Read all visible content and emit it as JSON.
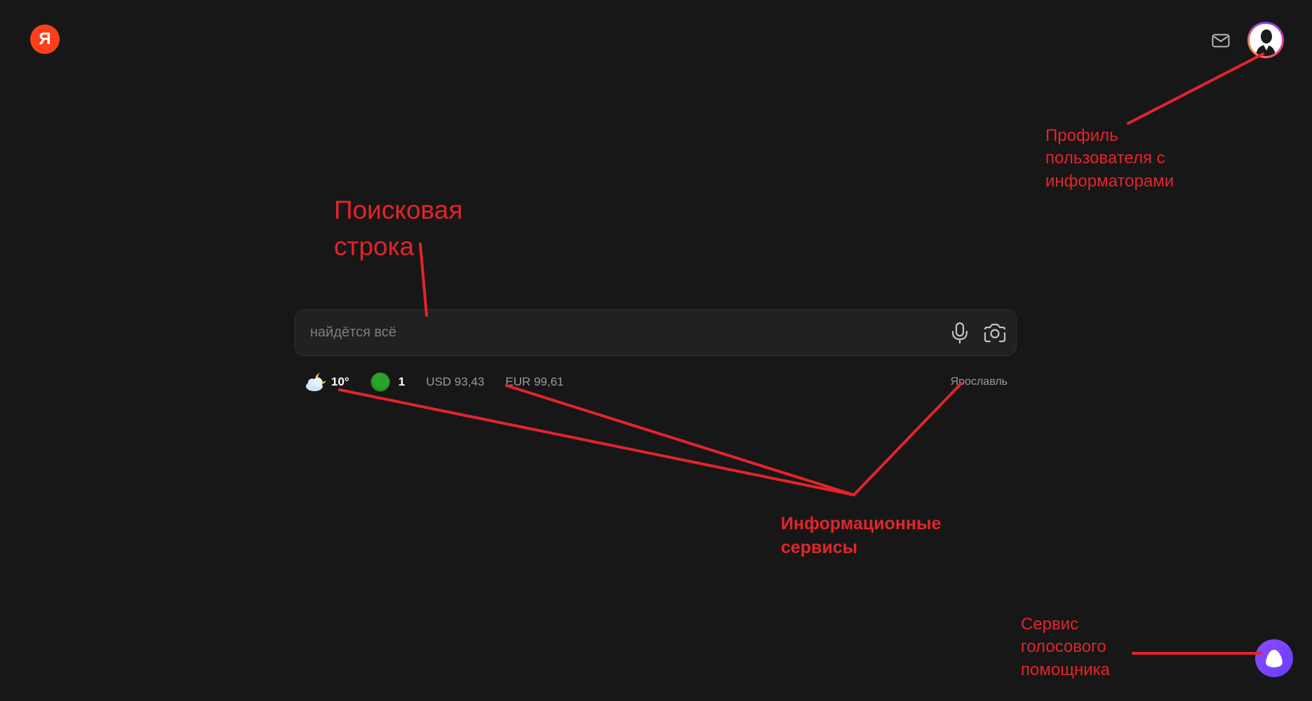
{
  "header": {
    "logo_letter": "Я",
    "logo_icon": "yandex-logo-icon",
    "mail_icon": "mail-icon",
    "avatar_icon": "user-avatar-icon"
  },
  "search": {
    "placeholder": "найдётся всё",
    "value": "",
    "voice_icon": "microphone-icon",
    "camera_icon": "camera-search-icon"
  },
  "informers": {
    "weather": {
      "icon": "cloud-moon-icon",
      "temperature": "10°"
    },
    "traffic": {
      "icon": "traffic-level-icon",
      "value": "1",
      "color": "#27a827"
    },
    "usd": "USD 93,43",
    "eur": "EUR 99,61",
    "city": "Ярославль"
  },
  "alice": {
    "icon": "alice-voice-assistant-icon",
    "color": "#7a45ff"
  },
  "annotations": {
    "color": "#e3242b",
    "search_bar": "Поисковая\nстрока",
    "profile": "Профиль\nпользователя с\nинформаторами",
    "info_services": "Информационные\nсервисы",
    "voice_assistant": "Сервис\nголосового\nпомощника"
  },
  "colors": {
    "background": "#171717",
    "search_bg": "#212123",
    "logo": "#fc3f1d"
  }
}
